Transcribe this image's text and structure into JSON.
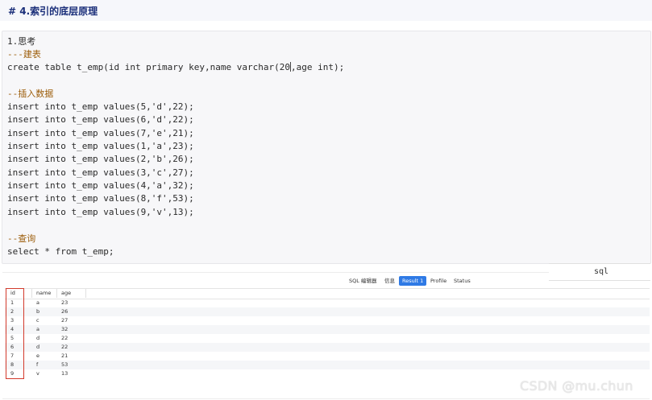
{
  "heading": "# 4.索引的底层原理",
  "code": {
    "lines": [
      {
        "text": "1.思考",
        "kind": "plain"
      },
      {
        "text": "---建表",
        "kind": "comment"
      },
      {
        "text": "create table t_emp(id int primary key,name varchar(20",
        "kind": "plain"
      },
      {
        "text": ",age int);",
        "kind": "plain"
      },
      {
        "text": "--插入数据",
        "kind": "comment"
      },
      {
        "text": "insert into t_emp values(5,'d',22);",
        "kind": "plain"
      },
      {
        "text": "insert into t_emp values(6,'d',22);",
        "kind": "plain"
      },
      {
        "text": "insert into t_emp values(7,'e',21);",
        "kind": "plain"
      },
      {
        "text": "insert into t_emp values(1,'a',23);",
        "kind": "plain"
      },
      {
        "text": "insert into t_emp values(2,'b',26);",
        "kind": "plain"
      },
      {
        "text": "insert into t_emp values(3,'c',27);",
        "kind": "plain"
      },
      {
        "text": "insert into t_emp values(4,'a',32);",
        "kind": "plain"
      },
      {
        "text": "insert into t_emp values(8,'f',53);",
        "kind": "plain"
      },
      {
        "text": "insert into t_emp values(9,'v',13);",
        "kind": "plain"
      },
      {
        "text": "--查询",
        "kind": "comment"
      },
      {
        "text": "select * from t_emp;",
        "kind": "plain"
      }
    ]
  },
  "sql_label": "sql",
  "tabs": [
    {
      "label": "SQL 编辑器",
      "active": false
    },
    {
      "label": "信息",
      "active": false
    },
    {
      "label": "Result 1",
      "active": true
    },
    {
      "label": "Profile",
      "active": false
    },
    {
      "label": "Status",
      "active": false
    }
  ],
  "table": {
    "columns": [
      "id",
      "name",
      "age"
    ],
    "rows": [
      [
        "1",
        "a",
        "23"
      ],
      [
        "2",
        "b",
        "26"
      ],
      [
        "3",
        "c",
        "27"
      ],
      [
        "4",
        "a",
        "32"
      ],
      [
        "5",
        "d",
        "22"
      ],
      [
        "6",
        "d",
        "22"
      ],
      [
        "7",
        "e",
        "21"
      ],
      [
        "8",
        "f",
        "53"
      ],
      [
        "9",
        "v",
        "13"
      ]
    ]
  },
  "watermark": "CSDN @mu.chun",
  "colors": {
    "heading": "#1b2f7a",
    "comment": "#9c5d0a",
    "active_tab": "#2f7ae5",
    "highlight": "#d33a2c"
  }
}
